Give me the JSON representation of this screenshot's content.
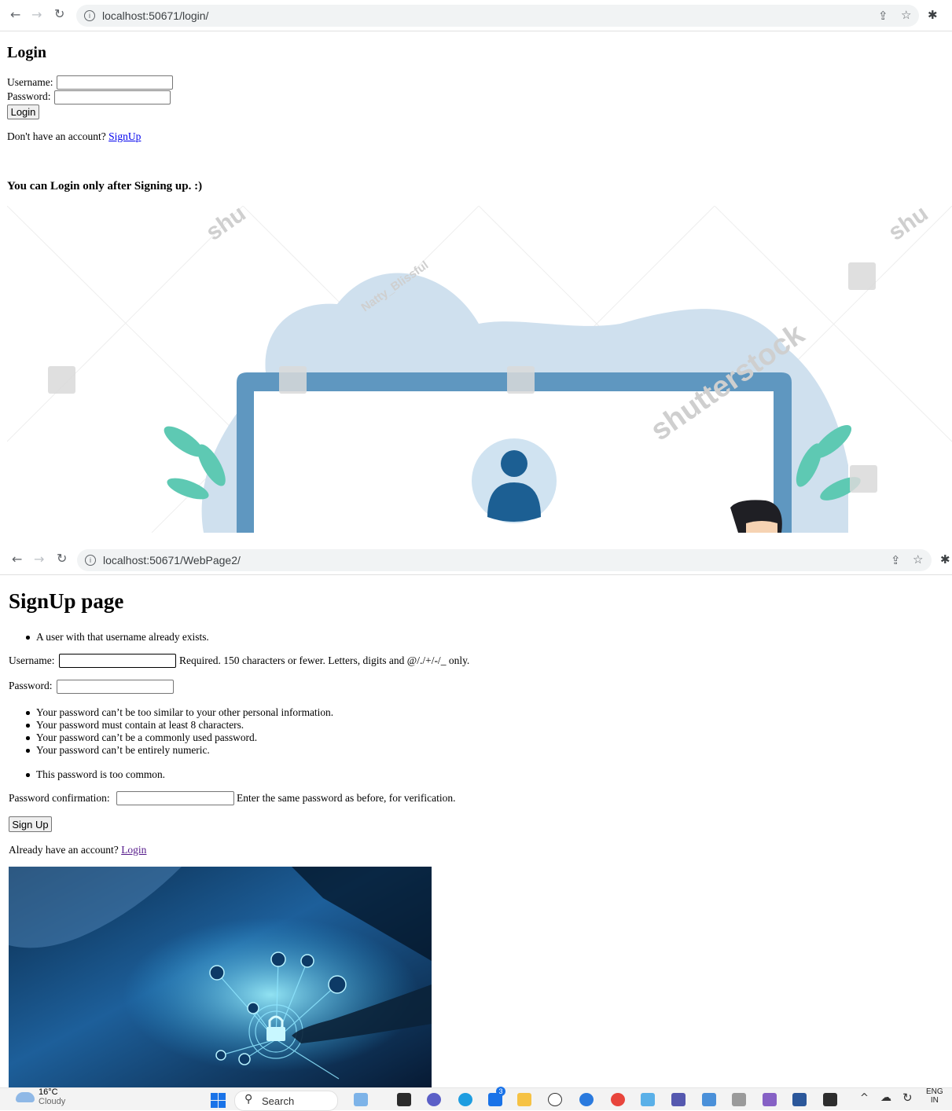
{
  "login_window": {
    "url": "localhost:50671/login/",
    "heading": "Login",
    "username_label": "Username:",
    "password_label": "Password:",
    "login_button": "Login",
    "no_account_text": "Don't have an account?",
    "signup_link": "SignUp",
    "note": "You can Login only after Signing up. :)",
    "watermarks": [
      "shutterstock",
      "Natty_Blissful",
      "shu",
      "shu"
    ]
  },
  "signup_window": {
    "url": "localhost:50671/WebPage2/",
    "heading": "SignUp page",
    "error_username": "A user with that username already exists.",
    "username_label": "Username:",
    "username_help": "Required. 150 characters or fewer. Letters, digits and @/./+/-/_ only.",
    "password_label": "Password:",
    "password_rules": [
      "Your password can’t be too similar to your other personal information.",
      "Your password must contain at least 8 characters.",
      "Your password can’t be a commonly used password.",
      "Your password can’t be entirely numeric."
    ],
    "error_password": "This password is too common.",
    "confirm_label": "Password confirmation:",
    "confirm_help": "Enter the same password as before, for verification.",
    "signup_button": "Sign Up",
    "have_account_text": "Already have an account?",
    "login_link": "Login"
  },
  "taskbar": {
    "weather_temp": "16°C",
    "weather_desc": "Cloudy",
    "search_label": "Search",
    "mail_badge": "3",
    "lang_line1": "ENG",
    "lang_line2": "IN"
  },
  "colors": {
    "link": "#0000ee",
    "link_visited": "#551a8b",
    "laptop_frame": "#5f97c0",
    "blob": "#cfe0ee",
    "leaf": "#5ec9b3",
    "avatar": "#1c5f93"
  }
}
